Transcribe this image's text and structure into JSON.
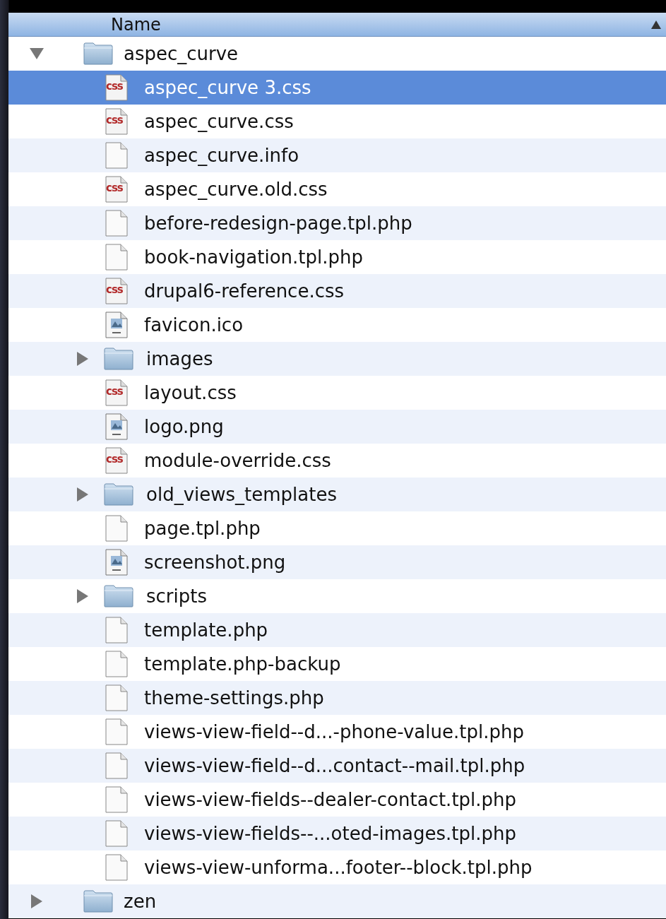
{
  "header": {
    "column_label": "Name",
    "sort_ascending": true
  },
  "items": [
    {
      "name": "aspec_curve",
      "kind": "folder",
      "expanded": true,
      "selected": false,
      "children": [
        {
          "name": "aspec_curve 3.css",
          "kind": "css",
          "icon_text": "css",
          "selected": true
        },
        {
          "name": "aspec_curve.css",
          "kind": "css",
          "icon_text": "css",
          "selected": false
        },
        {
          "name": "aspec_curve.info",
          "kind": "doc",
          "selected": false
        },
        {
          "name": "aspec_curve.old.css",
          "kind": "css",
          "icon_text": "css",
          "selected": false
        },
        {
          "name": "before-redesign-page.tpl.php",
          "kind": "doc",
          "selected": false
        },
        {
          "name": "book-navigation.tpl.php",
          "kind": "doc",
          "selected": false
        },
        {
          "name": "drupal6-reference.css",
          "kind": "css",
          "icon_text": "css",
          "selected": false
        },
        {
          "name": "favicon.ico",
          "kind": "image",
          "selected": false
        },
        {
          "name": "images",
          "kind": "folder",
          "expanded": false,
          "selected": false
        },
        {
          "name": "layout.css",
          "kind": "css",
          "icon_text": "css",
          "selected": false
        },
        {
          "name": "logo.png",
          "kind": "image",
          "selected": false
        },
        {
          "name": "module-override.css",
          "kind": "css",
          "icon_text": "css",
          "selected": false
        },
        {
          "name": "old_views_templates",
          "kind": "folder",
          "expanded": false,
          "selected": false
        },
        {
          "name": "page.tpl.php",
          "kind": "doc",
          "selected": false
        },
        {
          "name": "screenshot.png",
          "kind": "image",
          "selected": false
        },
        {
          "name": "scripts",
          "kind": "folder",
          "expanded": false,
          "selected": false
        },
        {
          "name": "template.php",
          "kind": "doc",
          "selected": false
        },
        {
          "name": "template.php-backup",
          "kind": "doc",
          "selected": false
        },
        {
          "name": "theme-settings.php",
          "kind": "doc",
          "selected": false
        },
        {
          "name": "views-view-field--d...-phone-value.tpl.php",
          "kind": "doc",
          "selected": false
        },
        {
          "name": "views-view-field--d...contact--mail.tpl.php",
          "kind": "doc",
          "selected": false
        },
        {
          "name": "views-view-fields--dealer-contact.tpl.php",
          "kind": "doc",
          "selected": false
        },
        {
          "name": "views-view-fields--...oted-images.tpl.php",
          "kind": "doc",
          "selected": false
        },
        {
          "name": "views-view-unforma...footer--block.tpl.php",
          "kind": "doc",
          "selected": false
        }
      ]
    },
    {
      "name": "zen",
      "kind": "folder",
      "expanded": false,
      "selected": false
    }
  ]
}
